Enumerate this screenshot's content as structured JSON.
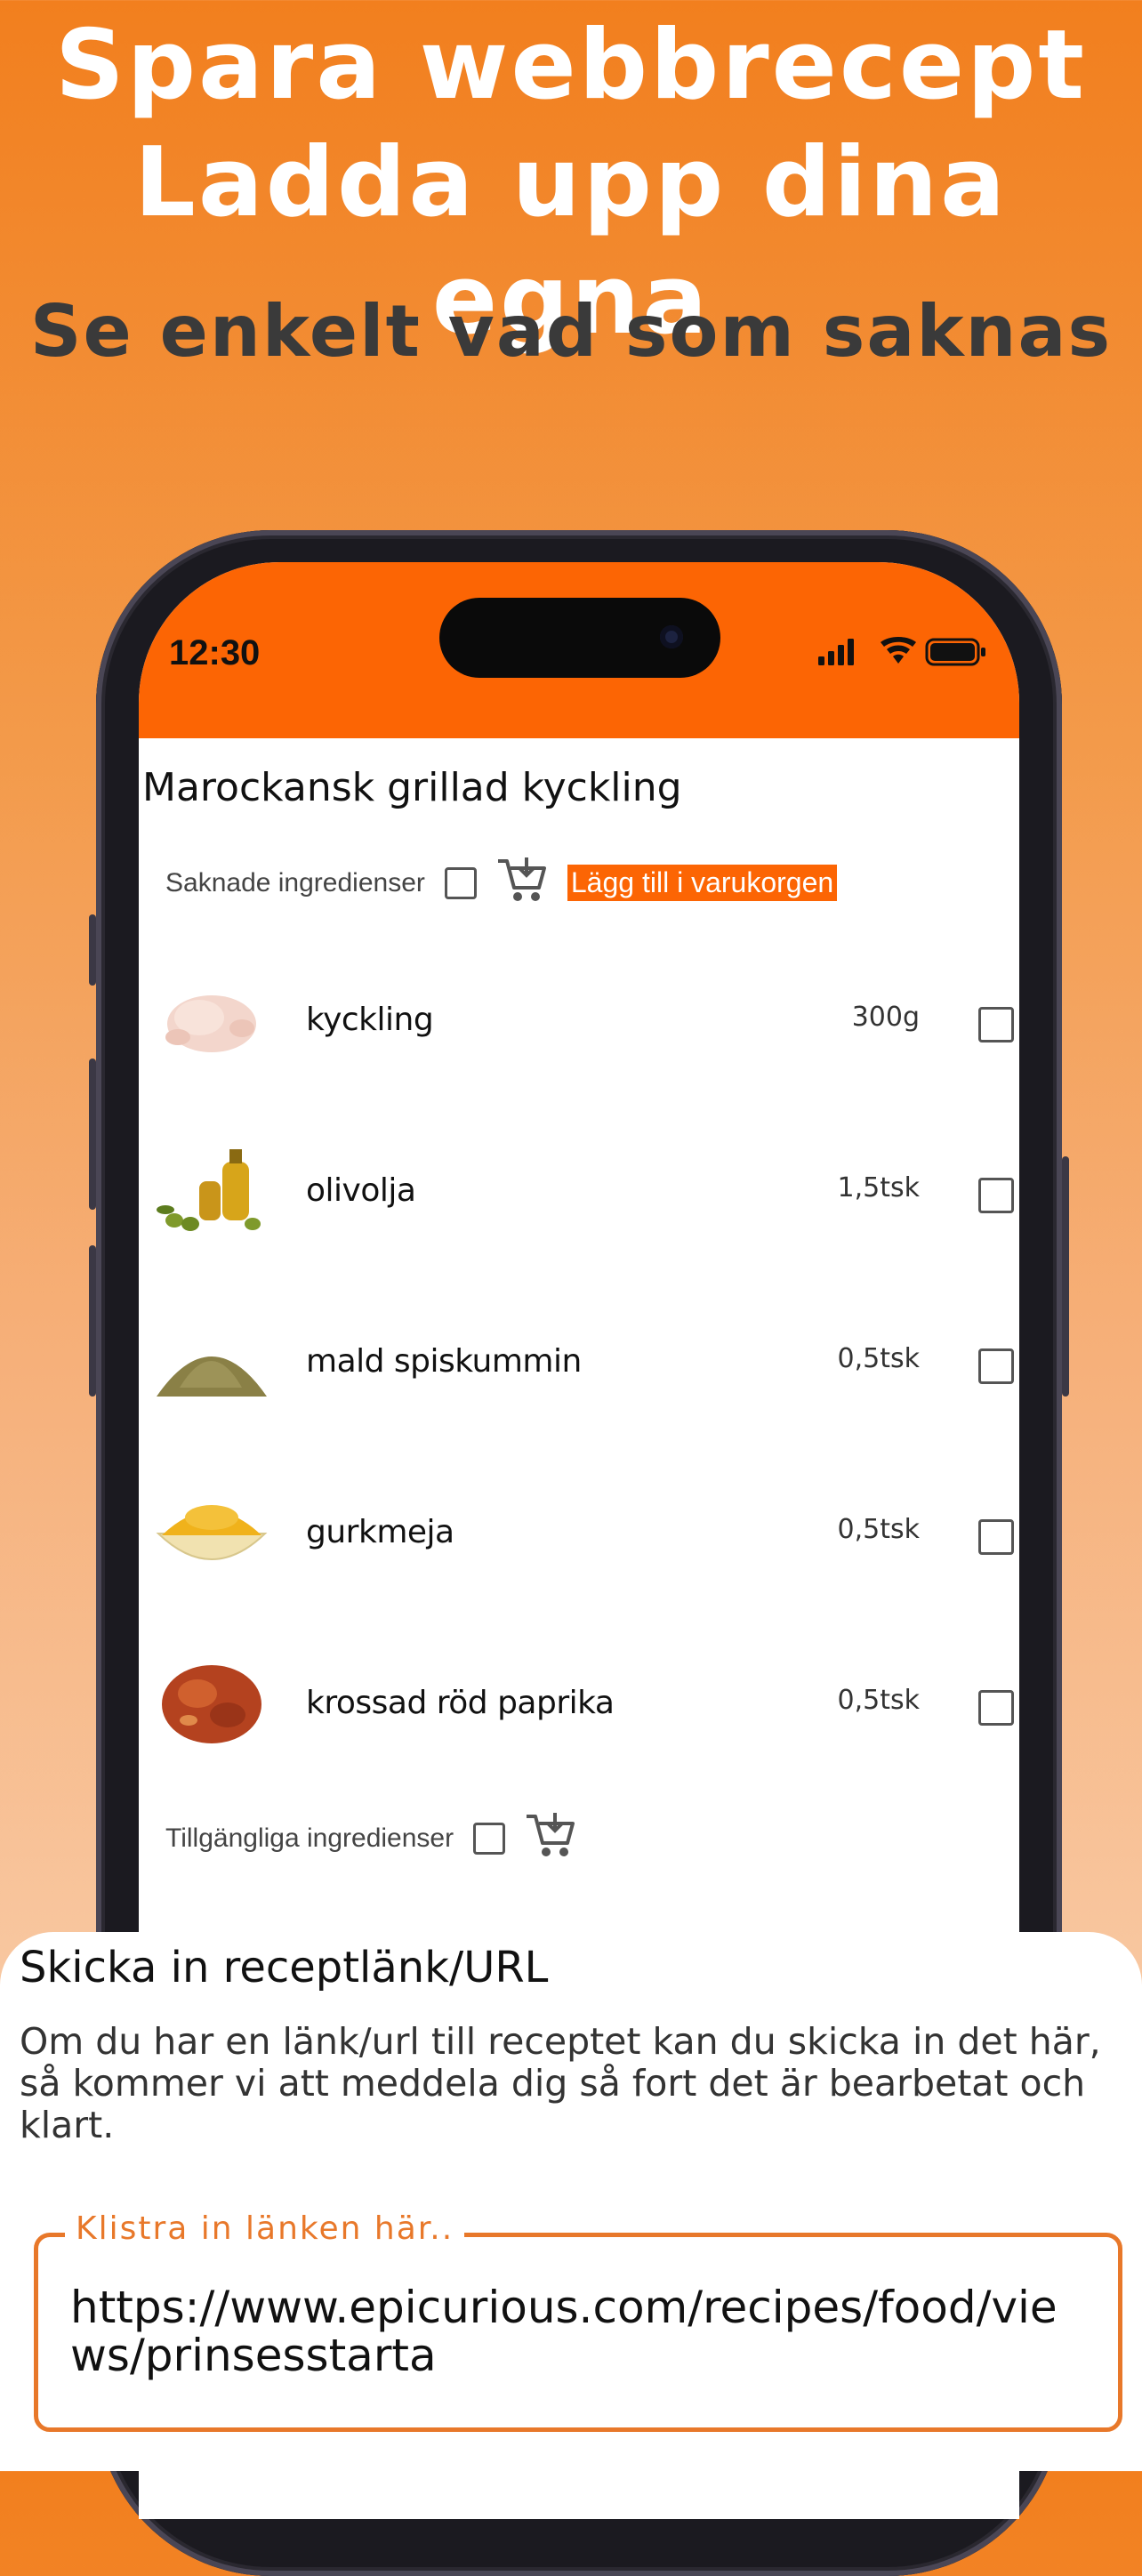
{
  "promo": {
    "line1": "Spara webbrecept",
    "line2": "Ladda upp dina egna",
    "line3": "Se enkelt vad som saknas"
  },
  "status_bar": {
    "time": "12:30",
    "accent": "#fc6504"
  },
  "recipe": {
    "title": "Marockansk grillad kyckling",
    "missing_label": "Saknade ingredienser",
    "add_to_cart_label": "Lägg till i varukorgen",
    "available_label": "Tillgängliga ingredienser",
    "ingredients": [
      {
        "name": "kyckling",
        "qty": "300g",
        "icon": "chicken-image"
      },
      {
        "name": "olivolja",
        "qty": "1,5tsk",
        "icon": "olive-oil-image"
      },
      {
        "name": "mald spiskummin",
        "qty": "0,5tsk",
        "icon": "cumin-image"
      },
      {
        "name": "gurkmeja",
        "qty": "0,5tsk",
        "icon": "turmeric-image"
      },
      {
        "name": "krossad röd paprika",
        "qty": "0,5tsk",
        "icon": "paprika-flakes-image"
      }
    ]
  },
  "sheet": {
    "title": "Skicka in receptlänk/URL",
    "description": "Om du har en länk/url till receptet kan du skicka in det här, så kommer vi att meddela dig så fort det är bearbetat och klart.",
    "input_label": "Klistra in länken här..",
    "input_value": "https://www.epicurious.com/recipes/food/views/prinsesstarta"
  }
}
